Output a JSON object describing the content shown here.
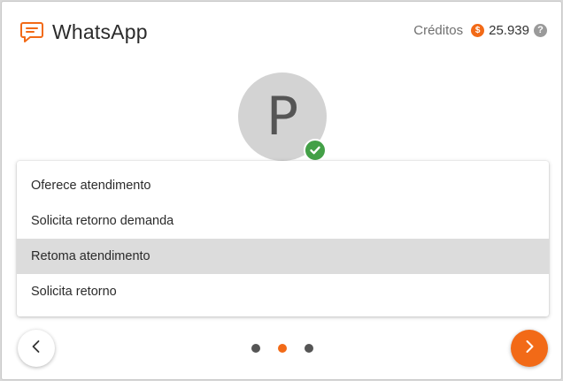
{
  "header": {
    "title": "WhatsApp",
    "credits_label": "Créditos",
    "coin_symbol": "$",
    "credits_value": "25.939",
    "help_symbol": "?"
  },
  "contact": {
    "avatar_letter": "P",
    "verified": true
  },
  "menu": {
    "items": [
      {
        "label": "Oferece atendimento",
        "selected": false
      },
      {
        "label": "Solicita retorno demanda",
        "selected": false
      },
      {
        "label": "Retoma atendimento",
        "selected": true
      },
      {
        "label": "Solicita retorno",
        "selected": false
      }
    ]
  },
  "pagination": {
    "total": 3,
    "active_index": 1
  },
  "colors": {
    "accent": "#f26a17",
    "verified": "#43a047",
    "avatar_bg": "#d3d3d3",
    "selected_bg": "#dcdcdc"
  },
  "icons": {
    "app": "chat-bubble-icon",
    "prev": "chevron-left-icon",
    "next": "chevron-right-icon",
    "verified": "check-icon"
  }
}
